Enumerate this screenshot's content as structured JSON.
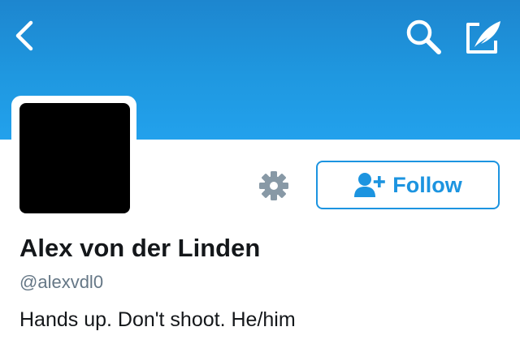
{
  "header": {
    "back_icon": "chevron-left-icon",
    "search_icon": "search-icon",
    "compose_icon": "compose-tweet-icon",
    "background_color": "#1f98e0"
  },
  "profile": {
    "avatar_color": "#000000",
    "name": "Alex von der Linden",
    "handle": "@alexvdl0",
    "bio": "Hands up. Don't shoot. He/him"
  },
  "actions": {
    "settings_icon": "gear-icon",
    "follow_icon": "add-user-icon",
    "follow_label": "Follow",
    "accent_color": "#1c94e0"
  }
}
